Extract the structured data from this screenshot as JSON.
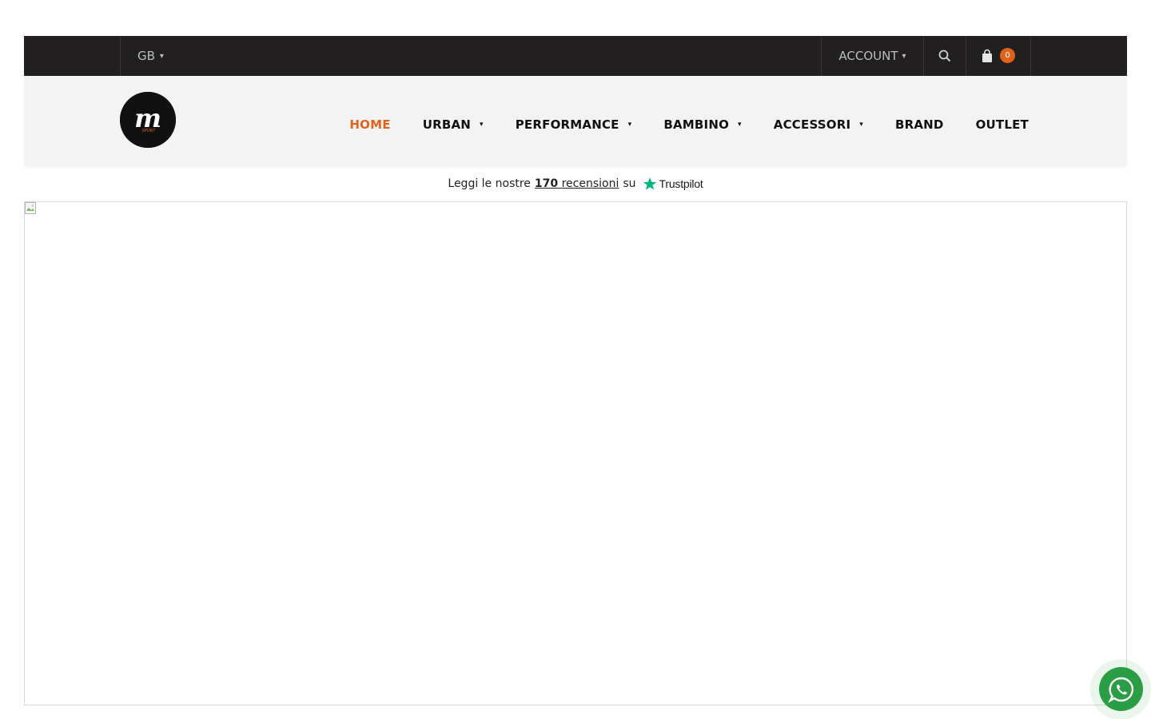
{
  "topbar": {
    "language": "GB",
    "account_label": "ACCOUNT",
    "cart_count": "0",
    "icons": [
      "chevron-down-icon",
      "search-icon",
      "cart-icon"
    ]
  },
  "header": {
    "logo_letter": "m",
    "logo_subtext": "SPORT",
    "nav": [
      {
        "label": "HOME",
        "active": true,
        "has_dropdown": false
      },
      {
        "label": "URBAN",
        "active": false,
        "has_dropdown": true
      },
      {
        "label": "PERFORMANCE",
        "active": false,
        "has_dropdown": true
      },
      {
        "label": "BAMBINO",
        "active": false,
        "has_dropdown": true
      },
      {
        "label": "ACCESSORI",
        "active": false,
        "has_dropdown": true
      },
      {
        "label": "BRAND",
        "active": false,
        "has_dropdown": false
      },
      {
        "label": "OUTLET",
        "active": false,
        "has_dropdown": false
      }
    ]
  },
  "reviews": {
    "prefix": "Leggi le nostre",
    "count": "170",
    "link_word": "recensioni",
    "suffix": "su",
    "brand": "Trustpilot"
  },
  "colors": {
    "topbar_bg": "#221f20",
    "header_bg": "#f3f3f3",
    "accent": "#e0621b",
    "trustpilot_green": "#00b67a",
    "whatsapp_green": "#2a9d45"
  }
}
